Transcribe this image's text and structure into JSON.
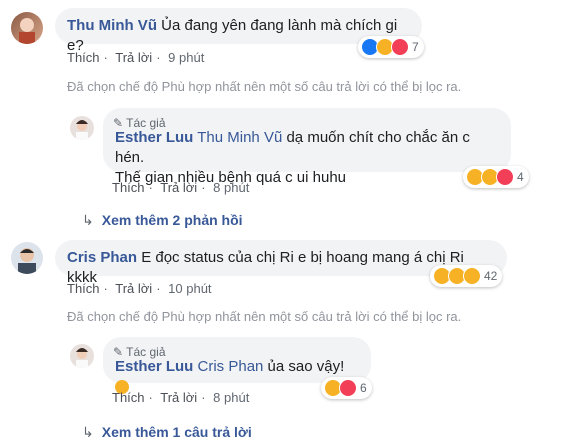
{
  "comments": [
    {
      "author": "Thu Minh Vũ",
      "text": "Ủa đang yên đang lành mà chích gi e?",
      "actions": {
        "like": "Thích",
        "reply": "Trả lời",
        "time": "9 phút"
      },
      "reaction_count": "7",
      "reaction_icons": [
        "like-icon",
        "haha-icon",
        "love-icon"
      ]
    },
    {
      "author": "Cris Phan",
      "text": "E đọc status của chị Ri e bị hoang mang á chị Ri kkkk",
      "actions": {
        "like": "Thích",
        "reply": "Trả lời",
        "time": "10 phút"
      },
      "reaction_count": "42",
      "reaction_icons": [
        "haha-icon",
        "wow-icon",
        "sad-icon"
      ]
    }
  ],
  "filter_note": "Đã chọn chế độ Phù hợp nhất nên một số câu trả lời có thể bị lọc ra.",
  "replies": [
    {
      "badge": "Tác giả",
      "author": "Esther Luu",
      "mention": "Thu Minh Vũ",
      "text_line1": "dạ muốn chít cho chắc ăn c hén.",
      "text_line2": "Thế gian nhiều bệnh quá c ui huhu",
      "actions": {
        "like": "Thích",
        "reply": "Trả lời",
        "time": "8 phút"
      },
      "reaction_count": "4",
      "reaction_icons": [
        "haha-icon",
        "sad-icon",
        "love-icon"
      ]
    },
    {
      "badge": "Tác giả",
      "author": "Esther Luu",
      "mention": "Cris Phan",
      "text_line1": "ủa sao vậy!",
      "actions": {
        "like": "Thích",
        "reply": "Trả lời",
        "time": "8 phút"
      },
      "reaction_count": "6",
      "reaction_icons": [
        "haha-icon",
        "love-icon"
      ]
    }
  ],
  "more_links": [
    "Xem thêm 2 phản hồi",
    "Xem thêm 1 câu trả lời"
  ],
  "colors": {
    "link": "#385898",
    "bubble": "#f2f3f5",
    "like": "#1877f2",
    "love": "#f33e58",
    "haha": "#f7b125"
  }
}
